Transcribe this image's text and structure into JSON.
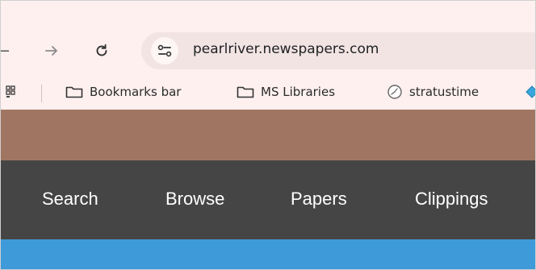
{
  "browser": {
    "address_bar": {
      "url": "pearlriver.newspapers.com"
    },
    "bookmarks": [
      {
        "label": "Bookmarks bar",
        "icon": "folder-icon"
      },
      {
        "label": "MS Libraries",
        "icon": "folder-icon"
      },
      {
        "label": "stratustime",
        "icon": "clock-icon"
      }
    ]
  },
  "site": {
    "nav": [
      {
        "label": "Search"
      },
      {
        "label": "Browse"
      },
      {
        "label": "Papers"
      },
      {
        "label": "Clippings"
      }
    ]
  }
}
